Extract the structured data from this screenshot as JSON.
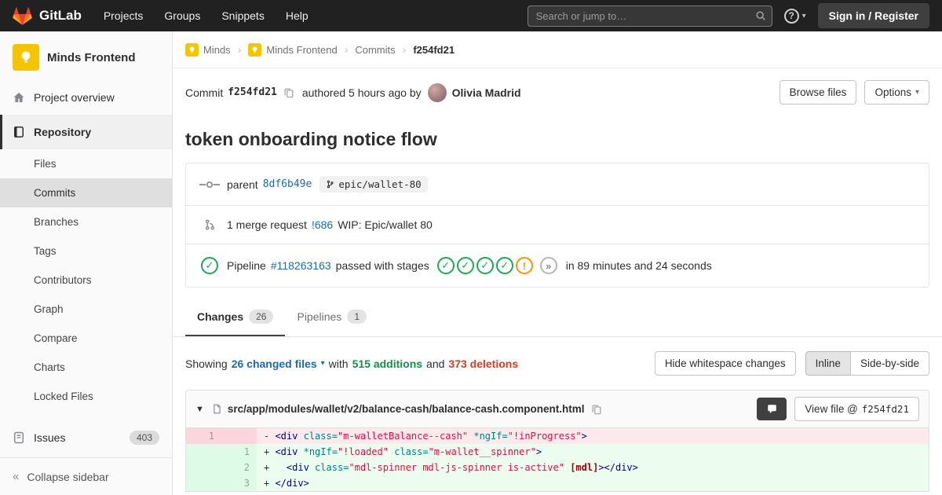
{
  "navbar": {
    "logo_text": "GitLab",
    "menu": [
      "Projects",
      "Groups",
      "Snippets",
      "Help"
    ],
    "search_placeholder": "Search or jump to…",
    "help_icon": "question-circle-icon",
    "sign_in_label": "Sign in / Register"
  },
  "sidebar": {
    "project_name": "Minds Frontend",
    "project_avatar_icon": "lightbulb-icon",
    "overview_label": "Project overview",
    "repository_label": "Repository",
    "repo_items": [
      "Files",
      "Commits",
      "Branches",
      "Tags",
      "Contributors",
      "Graph",
      "Compare",
      "Charts",
      "Locked Files"
    ],
    "active_item": "Repository",
    "active_sub_item": "Commits",
    "issues_label": "Issues",
    "issues_count": "403",
    "collapse_label": "Collapse sidebar"
  },
  "breadcrumb": {
    "items": [
      "Minds",
      "Minds Frontend",
      "Commits"
    ],
    "separator": "›",
    "current": "f254fd21"
  },
  "commit": {
    "label": "Commit",
    "sha": "f254fd21",
    "authored_text": "authored 5 hours ago by",
    "author": "Olivia Madrid",
    "browse_files_label": "Browse files",
    "options_label": "Options",
    "title": "token onboarding notice flow",
    "parent_label": "parent",
    "parent_sha": "8df6b49e",
    "branch": "epic/wallet-80",
    "merge_request_text": "1 merge request",
    "merge_request_id": "!686",
    "merge_request_title": "WIP: Epic/wallet 80",
    "pipeline_label": "Pipeline",
    "pipeline_id": "#118263163",
    "pipeline_status_text": "passed with stages",
    "pipeline_stages": [
      "success",
      "success",
      "success",
      "success",
      "warning",
      "skipped"
    ],
    "pipeline_duration": "in 89 minutes and 24 seconds"
  },
  "tabs": [
    {
      "label": "Changes",
      "count": "26",
      "active": true
    },
    {
      "label": "Pipelines",
      "count": "1",
      "active": false
    }
  ],
  "summary": {
    "showing_label": "Showing",
    "changed_files": "26 changed files",
    "with_label": "with",
    "additions": "515 additions",
    "and_label": "and",
    "deletions": "373 deletions",
    "hide_whitespace_label": "Hide whitespace changes",
    "inline_label": "Inline",
    "side_by_side_label": "Side-by-side"
  },
  "diff": {
    "file_path": "src/app/modules/wallet/v2/balance-cash/balance-cash.component.html",
    "view_file_label": "View file @",
    "view_file_sha": "f254fd21",
    "lines": [
      {
        "old": "1",
        "new": "",
        "type": "del",
        "segments": [
          {
            "c": "p",
            "t": "- "
          },
          {
            "c": "t",
            "t": "<div"
          },
          {
            "c": "p",
            "t": " "
          },
          {
            "c": "a",
            "t": "class="
          },
          {
            "c": "s",
            "t": "\"m-walletBalance--cash\""
          },
          {
            "c": "p",
            "t": " "
          },
          {
            "c": "a",
            "t": "*ngIf="
          },
          {
            "c": "s",
            "t": "\"!inProgress\""
          },
          {
            "c": "t",
            "t": ">"
          }
        ]
      },
      {
        "old": "",
        "new": "1",
        "type": "add",
        "segments": [
          {
            "c": "p",
            "t": "+ "
          },
          {
            "c": "t",
            "t": "<div"
          },
          {
            "c": "p",
            "t": " "
          },
          {
            "c": "a",
            "t": "*ngIf="
          },
          {
            "c": "s",
            "t": "\"!loaded\""
          },
          {
            "c": "p",
            "t": " "
          },
          {
            "c": "a",
            "t": "class="
          },
          {
            "c": "s",
            "t": "\"m-wallet__spinner\""
          },
          {
            "c": "t",
            "t": ">"
          }
        ]
      },
      {
        "old": "",
        "new": "2",
        "type": "add",
        "segments": [
          {
            "c": "p",
            "t": "+   "
          },
          {
            "c": "t",
            "t": "<div"
          },
          {
            "c": "p",
            "t": " "
          },
          {
            "c": "a",
            "t": "class="
          },
          {
            "c": "s",
            "t": "\"mdl-spinner mdl-js-spinner is-active\""
          },
          {
            "c": "p",
            "t": " "
          },
          {
            "c": "e",
            "t": "[mdl]"
          },
          {
            "c": "t",
            "t": "></div>"
          }
        ]
      },
      {
        "old": "",
        "new": "3",
        "type": "add",
        "segments": [
          {
            "c": "p",
            "t": "+ "
          },
          {
            "c": "t",
            "t": "</div>"
          }
        ]
      }
    ]
  },
  "colors": {
    "brand_orange": "#fc6d26",
    "link_blue": "#1b69b6",
    "success_green": "#1aaa55",
    "warning_orange": "#fc9403",
    "addition_text": "#168f48",
    "deletion_text": "#db3b21"
  }
}
